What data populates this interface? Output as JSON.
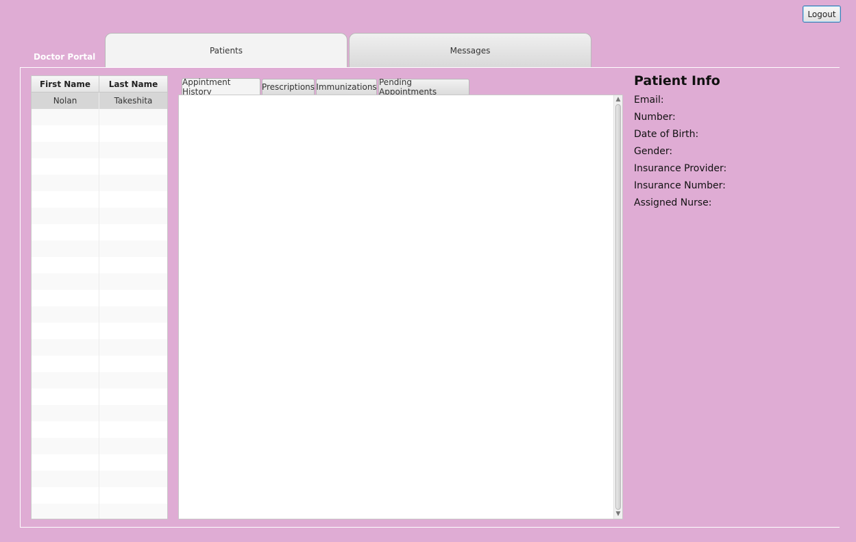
{
  "header": {
    "logout_label": "Logout",
    "portal_title": "Doctor Portal"
  },
  "main_tabs": [
    {
      "label": "Patients",
      "active": true
    },
    {
      "label": "Messages",
      "active": false
    }
  ],
  "patient_table": {
    "columns": [
      "First Name",
      "Last Name"
    ],
    "rows": [
      {
        "first": "Nolan",
        "last": "Takeshita",
        "selected": true
      }
    ],
    "empty_rows": 25
  },
  "sub_tabs": [
    {
      "label": "Appintment History",
      "active": true
    },
    {
      "label": "Prescriptions",
      "active": false
    },
    {
      "label": "Immunizations",
      "active": false
    },
    {
      "label": "Pending Appointments",
      "active": false
    }
  ],
  "patient_info": {
    "title": "Patient Info",
    "fields": [
      {
        "label": "Email:"
      },
      {
        "label": "Number:"
      },
      {
        "label": "Date of Birth:"
      },
      {
        "label": "Gender:"
      },
      {
        "label": "Insurance Provider:"
      },
      {
        "label": "Insurance Number:"
      },
      {
        "label": "Assigned Nurse:"
      }
    ]
  },
  "colors": {
    "background": "#dfacd4",
    "selected_row": "#d6d6d6",
    "button_border": "#3c7fb1"
  },
  "icons": {
    "scroll_up": "▲",
    "scroll_down": "▼"
  }
}
